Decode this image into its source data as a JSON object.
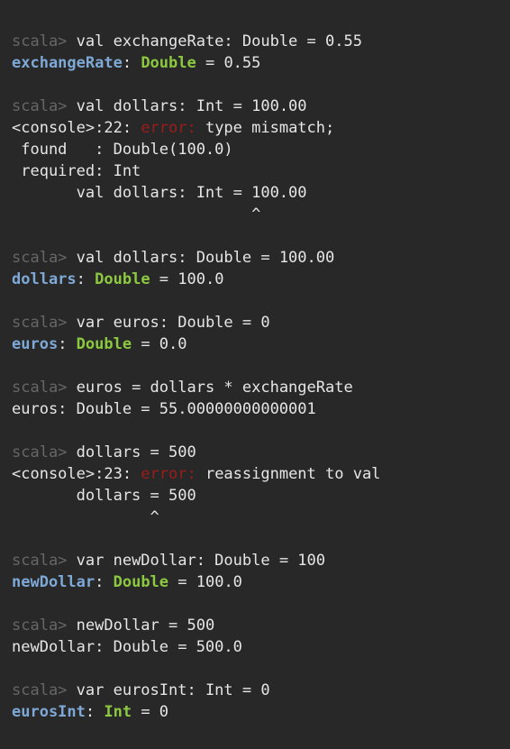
{
  "terminal": {
    "blocks": [
      {
        "input": "val exchangeRate: Double = 0.55",
        "output": [
          {
            "kind": "typed",
            "name": "exchangeRate",
            "sep": ": ",
            "type": "Double",
            "rest": " = 0.55"
          }
        ]
      },
      {
        "input": "val dollars: Int = 100.00",
        "output": [
          {
            "kind": "error",
            "pre": "<console>:22: ",
            "label": "error:",
            "msg": " type mismatch;"
          },
          {
            "kind": "text",
            "text": " found   : Double(100.0)"
          },
          {
            "kind": "text",
            "text": " required: Int"
          },
          {
            "kind": "text",
            "text": "       val dollars: Int = 100.00"
          },
          {
            "kind": "text",
            "text": "                          ^"
          }
        ]
      },
      {
        "input": "val dollars: Double = 100.00",
        "output": [
          {
            "kind": "typed",
            "name": "dollars",
            "sep": ": ",
            "type": "Double",
            "rest": " = 100.0"
          }
        ]
      },
      {
        "input": "var euros: Double = 0",
        "output": [
          {
            "kind": "typed",
            "name": "euros",
            "sep": ": ",
            "type": "Double",
            "rest": " = 0.0"
          }
        ]
      },
      {
        "input": "euros = dollars * exchangeRate",
        "output": [
          {
            "kind": "text",
            "text": "euros: Double = 55.00000000000001"
          }
        ]
      },
      {
        "input": "dollars = 500",
        "output": [
          {
            "kind": "error",
            "pre": "<console>:23: ",
            "label": "error:",
            "msg": " reassignment to val"
          },
          {
            "kind": "text",
            "text": "       dollars = 500"
          },
          {
            "kind": "text",
            "text": "               ^"
          }
        ]
      },
      {
        "input": "var newDollar: Double = 100",
        "output": [
          {
            "kind": "typed",
            "name": "newDollar",
            "sep": ": ",
            "type": "Double",
            "rest": " = 100.0"
          }
        ]
      },
      {
        "input": "newDollar = 500",
        "output": [
          {
            "kind": "text",
            "text": "newDollar: Double = 500.0"
          }
        ]
      },
      {
        "input": "var eurosInt: Int = 0",
        "output": [
          {
            "kind": "typed",
            "name": "eurosInt",
            "sep": ": ",
            "type": "Int",
            "rest": " = 0"
          }
        ]
      }
    ],
    "prompt": "scala> ",
    "colors": {
      "background": "#282828",
      "text": "#e6e6e6",
      "prompt": "#666666",
      "error": "#9b1c1c",
      "name": "#7ea8d6",
      "type": "#8cc840"
    }
  }
}
